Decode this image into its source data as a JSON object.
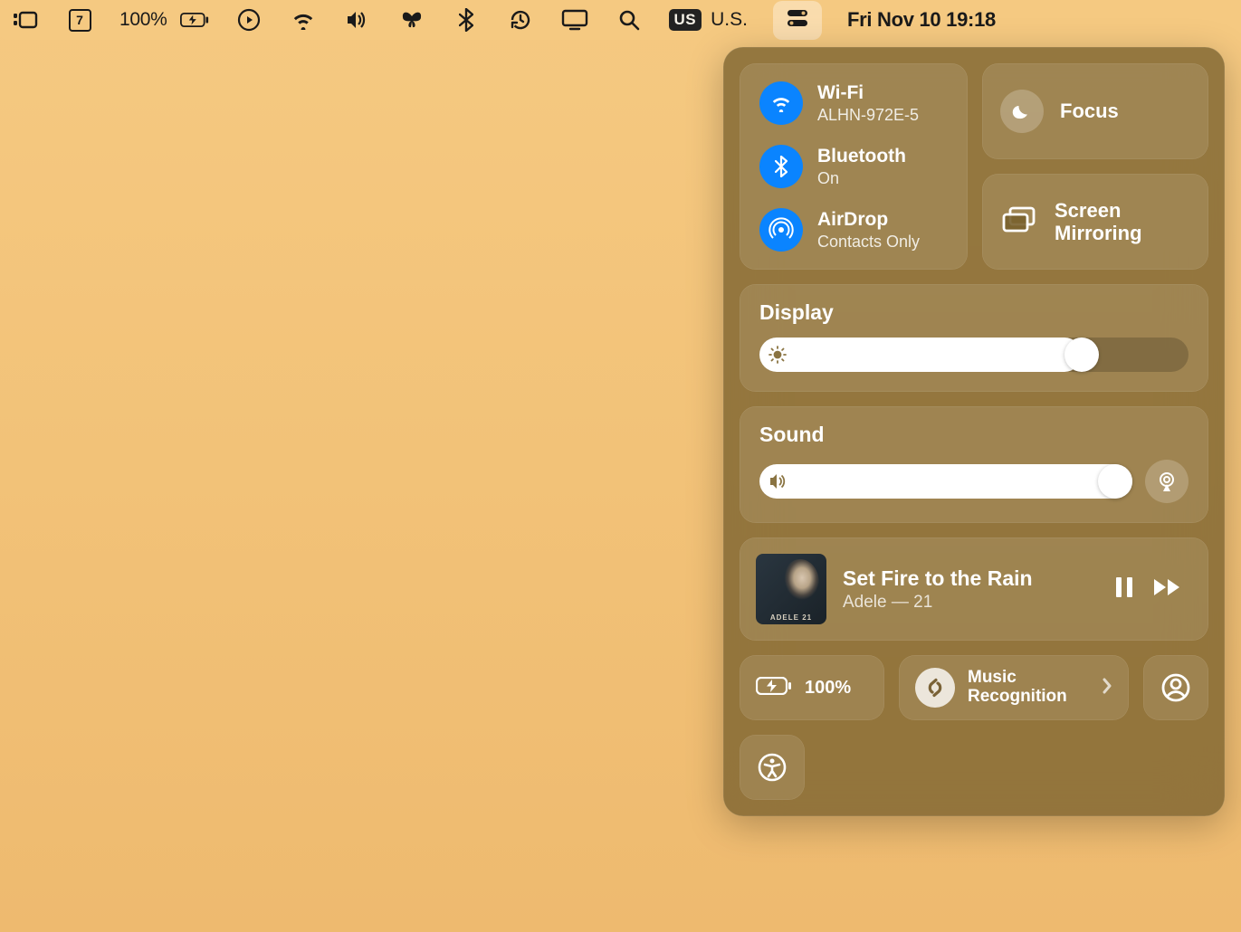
{
  "menubar": {
    "calendar_day": "7",
    "battery_percent": "100%",
    "input_badge": "US",
    "input_label": "U.S.",
    "clock": "Fri Nov 10  19:18"
  },
  "control_center": {
    "wifi": {
      "title": "Wi-Fi",
      "sub": "ALHN-972E-5"
    },
    "bluetooth": {
      "title": "Bluetooth",
      "sub": "On"
    },
    "airdrop": {
      "title": "AirDrop",
      "sub": "Contacts Only"
    },
    "focus": {
      "label": "Focus"
    },
    "screen_mirroring": {
      "label": "Screen\nMirroring"
    },
    "display": {
      "heading": "Display",
      "value_percent": 75
    },
    "sound": {
      "heading": "Sound",
      "value_percent": 100
    },
    "now_playing": {
      "title": "Set Fire to the Rain",
      "subtitle": "Adele — 21",
      "album_art_text": "ADELE 21"
    },
    "bottom": {
      "battery": "100%",
      "music_recognition": "Music\nRecognition"
    }
  }
}
